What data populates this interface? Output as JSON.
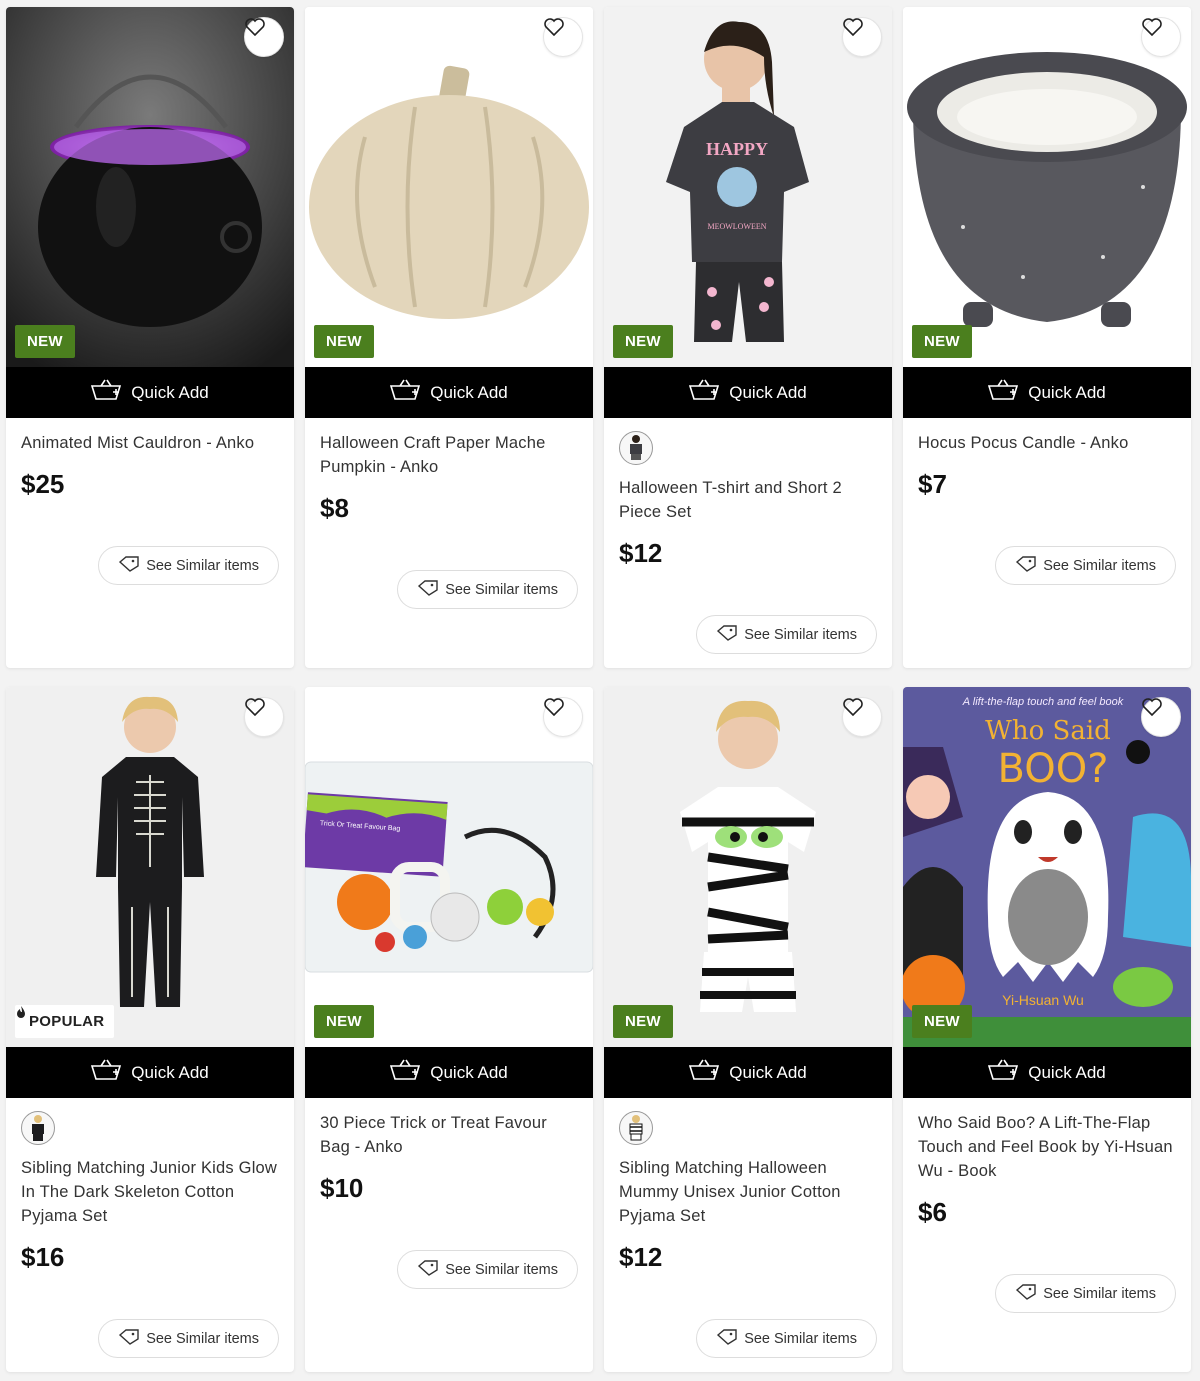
{
  "quick_add_label": "Quick Add",
  "see_similar_label": "See Similar items",
  "products": [
    {
      "title": "Animated Mist Cauldron - Anko",
      "price": "$25",
      "badge": "NEW",
      "image": "cauldron"
    },
    {
      "title": "Halloween Craft Paper Mache Pumpkin - Anko",
      "price": "$8",
      "badge": "NEW",
      "image": "pumpkin"
    },
    {
      "title": "Halloween T-shirt and Short 2 Piece Set",
      "price": "$12",
      "badge": "NEW",
      "image": "girl-happy-meowloween-set",
      "shirt_text": "HAPPY",
      "shirt_subtext": "MEOWLOWEEN"
    },
    {
      "title": "Hocus Pocus Candle - Anko",
      "price": "$7",
      "badge": "NEW",
      "image": "cauldron-candle"
    },
    {
      "title": "Sibling Matching Junior Kids Glow In The Dark Skeleton Cotton Pyjama Set",
      "price": "$16",
      "badge": "POPULAR",
      "image": "skeleton-pyjamas"
    },
    {
      "title": "30 Piece Trick or Treat Favour Bag - Anko",
      "price": "$10",
      "badge": "NEW",
      "image": "favour-bag",
      "bag_label": "Trick Or Treat Favour Bag"
    },
    {
      "title": "Sibling Matching Halloween Mummy Unisex Junior Cotton Pyjama Set",
      "price": "$12",
      "badge": "NEW",
      "image": "mummy-pyjamas"
    },
    {
      "title": "Who Said Boo? A Lift-The-Flap Touch and Feel Book by Yi-Hsuan Wu - Book",
      "price": "$6",
      "badge": "NEW",
      "image": "book-cover",
      "book_tagline": "A lift-the-flap touch and feel book",
      "book_title_1": "Who Said",
      "book_title_2": "BOO?",
      "book_author": "Yi-Hsuan Wu"
    }
  ]
}
